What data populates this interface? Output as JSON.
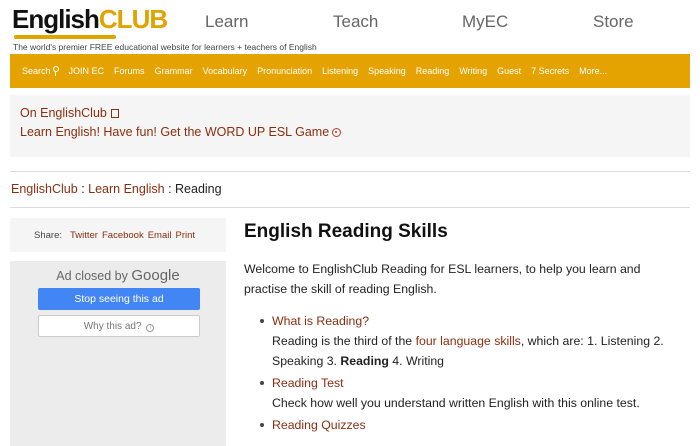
{
  "header": {
    "logo_english": "English",
    "logo_club": "CLUB",
    "tagline": "The world's premier FREE educational website for learners + teachers of English",
    "nav": [
      "Learn",
      "Teach",
      "MyEC",
      "Store"
    ]
  },
  "menubar": {
    "items": [
      "Search",
      "JOIN EC",
      "Forums",
      "Grammar",
      "Vocabulary",
      "Pronunciation",
      "Listening",
      "Speaking",
      "Reading",
      "Writing",
      "Guest",
      "7 Secrets",
      "More..."
    ]
  },
  "promo": {
    "line1": "On EnglishClub",
    "line2": "Learn English! Have fun! Get the WORD UP ESL Game"
  },
  "breadcrumb": {
    "home": "EnglishClub",
    "sep1": " : ",
    "section": "Learn English",
    "sep2": " : ",
    "current": "Reading"
  },
  "share": {
    "label": "Share:",
    "links": [
      "Twitter",
      "Facebook",
      "Email",
      "Print"
    ]
  },
  "ad": {
    "closed_text": "Ad closed by",
    "google": "Google",
    "stop_label": "Stop seeing this ad",
    "why_label": "Why this ad?",
    "info_glyph": "i"
  },
  "main": {
    "title": "English Reading Skills",
    "intro": "Welcome to EnglishClub Reading for ESL learners, to help you learn and practise the skill of reading English.",
    "items": [
      {
        "title": "What is Reading?",
        "desc_a": "Reading is the third of the ",
        "desc_link": "four language skills",
        "desc_b": ", which are: 1. Listening 2. Speaking 3. ",
        "desc_bold": "Reading",
        "desc_c": " 4. Writing"
      },
      {
        "title": "Reading Test",
        "desc": "Check how well you understand written English with this online test."
      },
      {
        "title": "Reading Quizzes"
      }
    ]
  },
  "colors": {
    "accent": "#e4a300",
    "link": "#8b2e0f",
    "ad_button": "#4285f4"
  }
}
